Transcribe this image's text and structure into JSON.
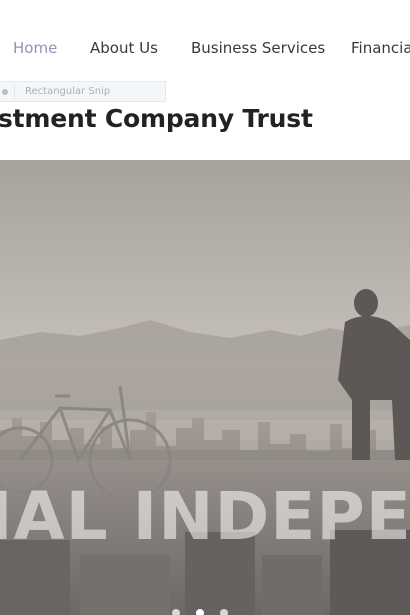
{
  "nav": {
    "items": [
      {
        "label": "Home",
        "active": true
      },
      {
        "label": "About Us",
        "active": false
      },
      {
        "label": "Business Services",
        "active": false
      },
      {
        "label": "Financia",
        "active": false
      }
    ],
    "active_color": "#9b8fb5",
    "text_color": "#3a3a3a"
  },
  "snip_toolbar": {
    "label": "Rectangular Snip",
    "icon": "snip-dot-icon"
  },
  "page": {
    "title": "stment Company Trust"
  },
  "hero": {
    "overlay_text": "IAL INDEPEN",
    "slides": 3,
    "active_slide": 2
  }
}
